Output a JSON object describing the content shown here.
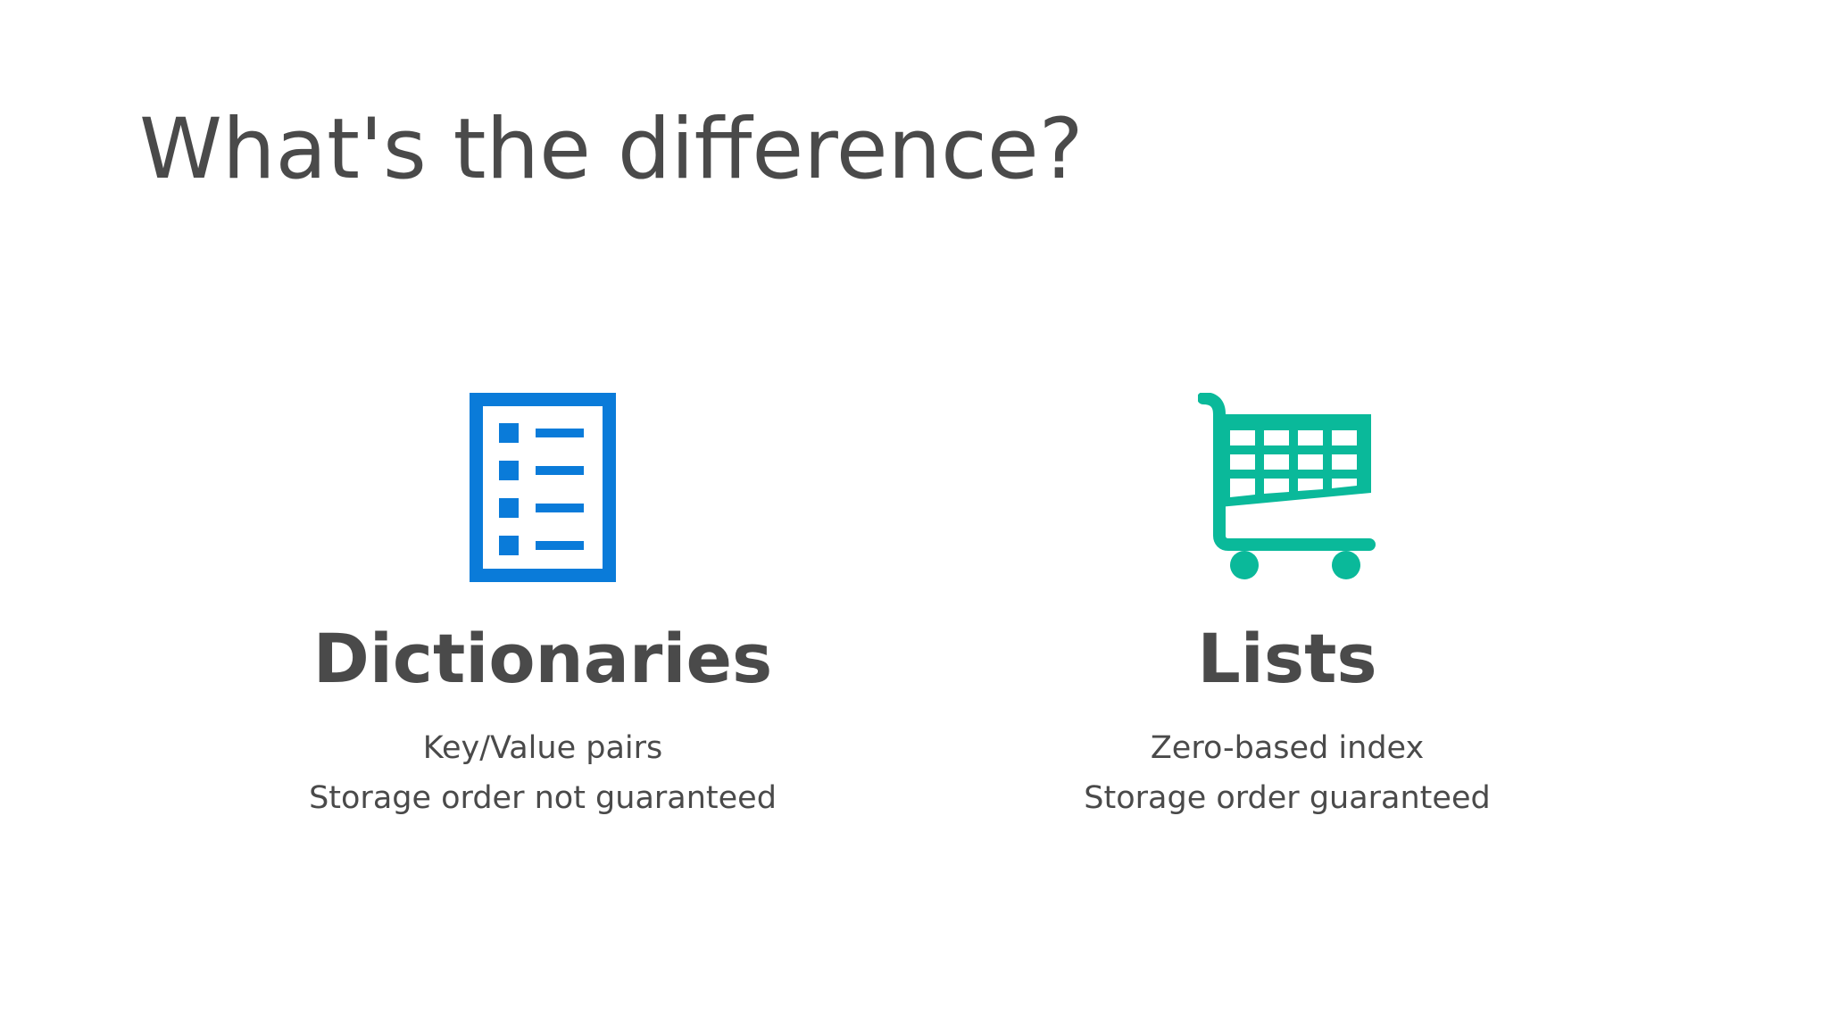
{
  "slide": {
    "title": "What's the difference?"
  },
  "columns": [
    {
      "icon": "document-list-icon",
      "icon_color": "#0a7bd9",
      "heading": "Dictionaries",
      "lines": [
        "Key/Value pairs",
        "Storage order not guaranteed"
      ]
    },
    {
      "icon": "shopping-cart-icon",
      "icon_color": "#0ab99a",
      "heading": "Lists",
      "lines": [
        "Zero-based index",
        "Storage order guaranteed"
      ]
    }
  ],
  "colors": {
    "text": "#4a4a4a",
    "background": "#ffffff"
  }
}
